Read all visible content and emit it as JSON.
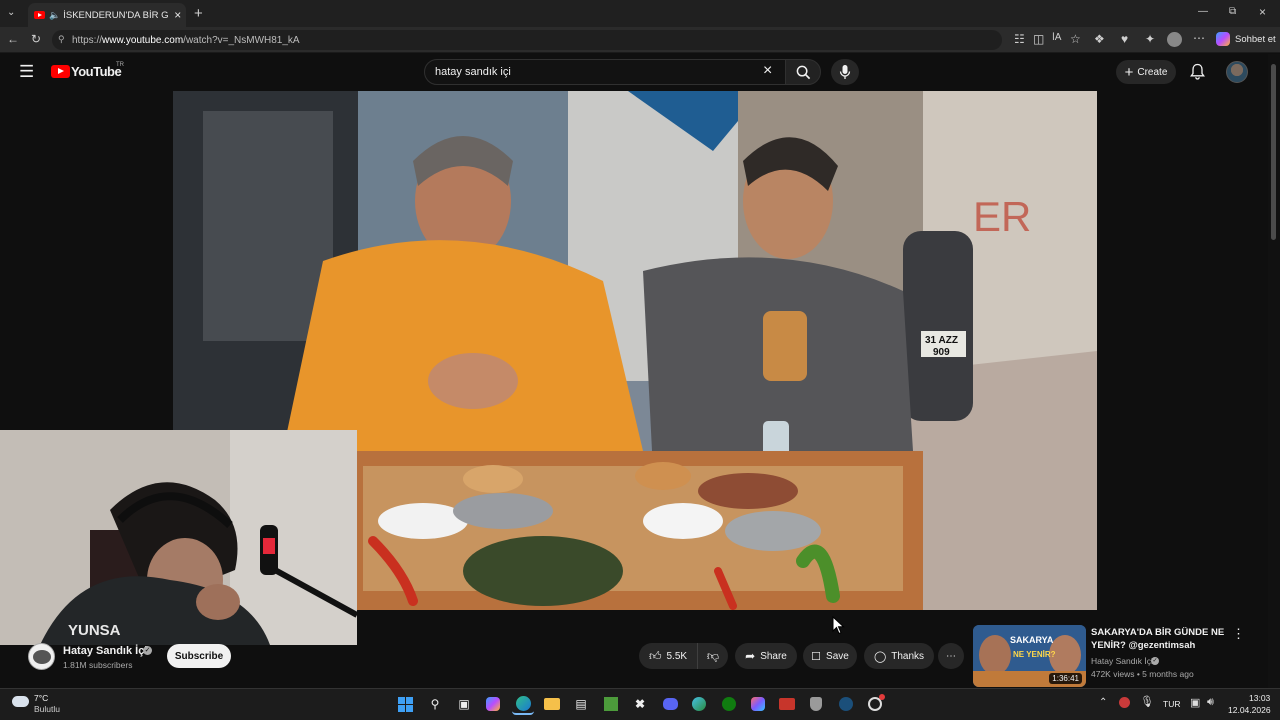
{
  "browser": {
    "tab_title": "İSKENDERUN'DA BİR GÜNDE",
    "new_tab_icon": "plus",
    "url_prefix": "https://",
    "url_domain": "www.youtube.com",
    "url_path": "/watch?v=_NsMWH81_kA",
    "copilot_label": "Sohbet et"
  },
  "youtube": {
    "logo_text": "YouTube",
    "region": "TR",
    "search_value": "hatay sandık içi",
    "create_label": "Create"
  },
  "channel": {
    "name": "Hatay Sandık İçi",
    "subscribers": "1.81M subscribers",
    "subscribe_label": "Subscribe"
  },
  "actions": {
    "likes": "5.5K",
    "share": "Share",
    "save": "Save",
    "thanks": "Thanks"
  },
  "recommended": {
    "title_line1": "SAKARYA'DA BİR GÜNDE NE",
    "title_line2": "YENİR? @gezentimsah",
    "channel": "Hatay Sandık İçi",
    "meta": "472K views • 5 months ago",
    "duration": "1:36:41",
    "thumb_text1": "SAKARYA",
    "thumb_text2": "NE YENİR?"
  },
  "webcam": {
    "shirt_text": "YUNSA"
  },
  "video": {
    "plate_text1": "31 AZZ",
    "plate_text2": "909"
  },
  "taskbar": {
    "weather_temp": "7°C",
    "weather_desc": "Bulutlu",
    "language": "TUR",
    "time": "13:03",
    "date": "12.04.2026"
  },
  "colors": {
    "youtube_red": "#ff0000",
    "bg": "#0f0f0f",
    "hoodie_orange": "#e8952b"
  }
}
